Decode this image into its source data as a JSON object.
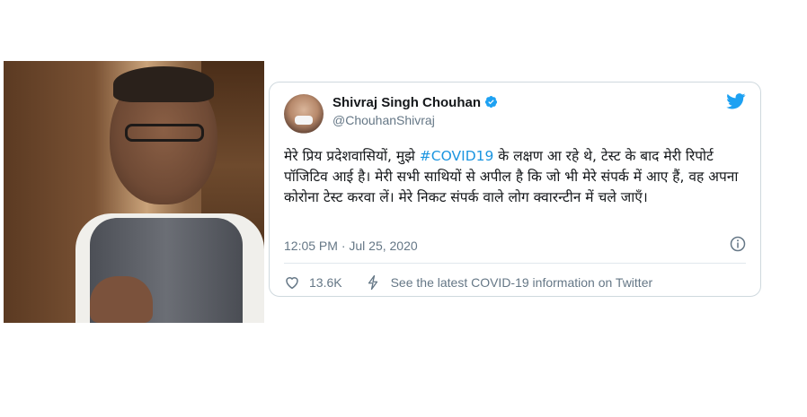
{
  "tweet": {
    "author_name": "Shivraj Singh Chouhan",
    "author_handle": "@ChouhanShivraj",
    "text_before": "मेरे प्रिय प्रदेशवासियों, मुझे ",
    "hashtag": "#COVID19",
    "text_after": " के लक्षण आ रहे थे, टेस्ट के बाद मेरी रिपोर्ट पॉजिटिव आई है। मेरी सभी साथियों से अपील है कि जो भी मेरे संपर्क में आए हैं, वह अपना कोरोना टेस्ट करवा लें। मेरे निकट संपर्क वाले लोग क्वारन्टीन में चले जाएँ।",
    "timestamp": "12:05 PM · Jul 25, 2020",
    "likes": "13.6K",
    "covid_info": "See the latest COVID-19 information on Twitter"
  },
  "icons": {
    "verified": "verified-badge-icon",
    "bird": "twitter-bird-icon",
    "info": "info-icon",
    "heart": "heart-icon",
    "bolt": "lightning-bolt-icon"
  },
  "colors": {
    "twitter_blue": "#1da1f2",
    "hashtag": "#1b95e0",
    "secondary_text": "#657786",
    "border": "#cfd9de"
  }
}
